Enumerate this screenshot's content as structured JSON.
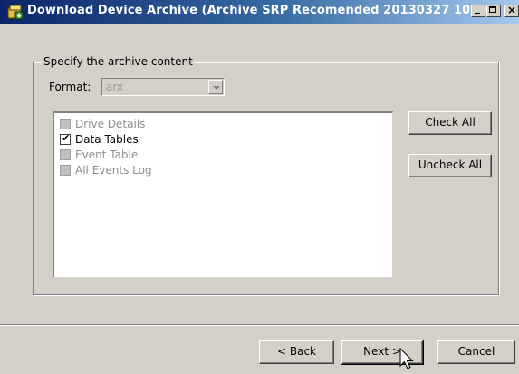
{
  "window": {
    "title": "Download Device Archive (Archive SRP Recomended 20130327 1039...",
    "close_glyph": "×"
  },
  "content_group": {
    "legend": "Specify the archive content",
    "format_label": "Format:",
    "format_value": "arx"
  },
  "archive_items": [
    {
      "label": "Drive Details",
      "checked": false,
      "enabled": false
    },
    {
      "label": "Data Tables",
      "checked": true,
      "enabled": true
    },
    {
      "label": "Event Table",
      "checked": false,
      "enabled": false
    },
    {
      "label": "All Events Log",
      "checked": false,
      "enabled": false
    }
  ],
  "checkmark_glyph": "✔",
  "buttons": {
    "check_all": "Check All",
    "uncheck_all": "Uncheck All",
    "back": "< Back",
    "next": "Next >",
    "cancel": "Cancel"
  }
}
